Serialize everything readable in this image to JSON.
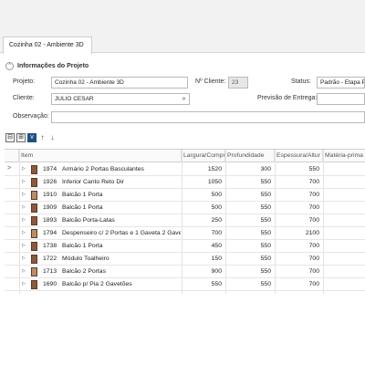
{
  "tab": {
    "label": "Cozinha 02 - Ambiente 3D"
  },
  "section": {
    "collapse_glyph": "^",
    "title": "Informações do Projeto"
  },
  "form": {
    "projeto_label": "Projeto:",
    "projeto_value": "Cozinha 02 - Ambiente 3D",
    "ncliente_label": "Nº Cliente:",
    "ncliente_value": "23",
    "status_label": "Status:",
    "status_value": "Padrão - Etapa P",
    "cliente_label": "Cliente:",
    "cliente_value": "JULIO CESAR",
    "cliente_dropdown_glyph": "»",
    "previsao_label": "Previsão de Entrega:",
    "previsao_value": "",
    "observacao_label": "Observação:",
    "observacao_value": ""
  },
  "toolbar": {
    "collapse_all": "⊟",
    "expand_all": "⊞",
    "view_mode": "v",
    "move_up": "↑",
    "move_down": "↓"
  },
  "grid": {
    "columns": [
      "Item",
      "Largura/Compr",
      "Profundidade",
      "Espessura/Altur",
      "Matéria-prima"
    ],
    "selected_indicator": ">",
    "expander_glyph": "▷",
    "rows": [
      {
        "code": "1974",
        "name": "Armário 2 Portas Basculantes",
        "largura": "1520",
        "prof": "300",
        "esp": "550",
        "materia": ""
      },
      {
        "code": "1926",
        "name": "Inferior Canto Reto Dir",
        "largura": "1050",
        "prof": "550",
        "esp": "700",
        "materia": ""
      },
      {
        "code": "1910",
        "name": "Balcão 1 Porta",
        "largura": "500",
        "prof": "550",
        "esp": "700",
        "materia": ""
      },
      {
        "code": "1909",
        "name": "Balcão 1 Porta",
        "largura": "500",
        "prof": "550",
        "esp": "700",
        "materia": ""
      },
      {
        "code": "1893",
        "name": "Balcão Porta-Latas",
        "largura": "250",
        "prof": "550",
        "esp": "700",
        "materia": ""
      },
      {
        "code": "1794",
        "name": "Despenseiro c/ 2 Portas e 1 Gaveta 2 Gavet",
        "largura": "700",
        "prof": "550",
        "esp": "2100",
        "materia": ""
      },
      {
        "code": "1738",
        "name": "Balcão 1 Porta",
        "largura": "450",
        "prof": "550",
        "esp": "700",
        "materia": ""
      },
      {
        "code": "1722",
        "name": "Módulo Toalheiro",
        "largura": "150",
        "prof": "550",
        "esp": "700",
        "materia": ""
      },
      {
        "code": "1713",
        "name": "Balcão 2 Portas",
        "largura": "900",
        "prof": "550",
        "esp": "700",
        "materia": ""
      },
      {
        "code": "1690",
        "name": "Balcão p/ Pia 2 Gavetões",
        "largura": "550",
        "prof": "550",
        "esp": "700",
        "materia": ""
      }
    ]
  }
}
